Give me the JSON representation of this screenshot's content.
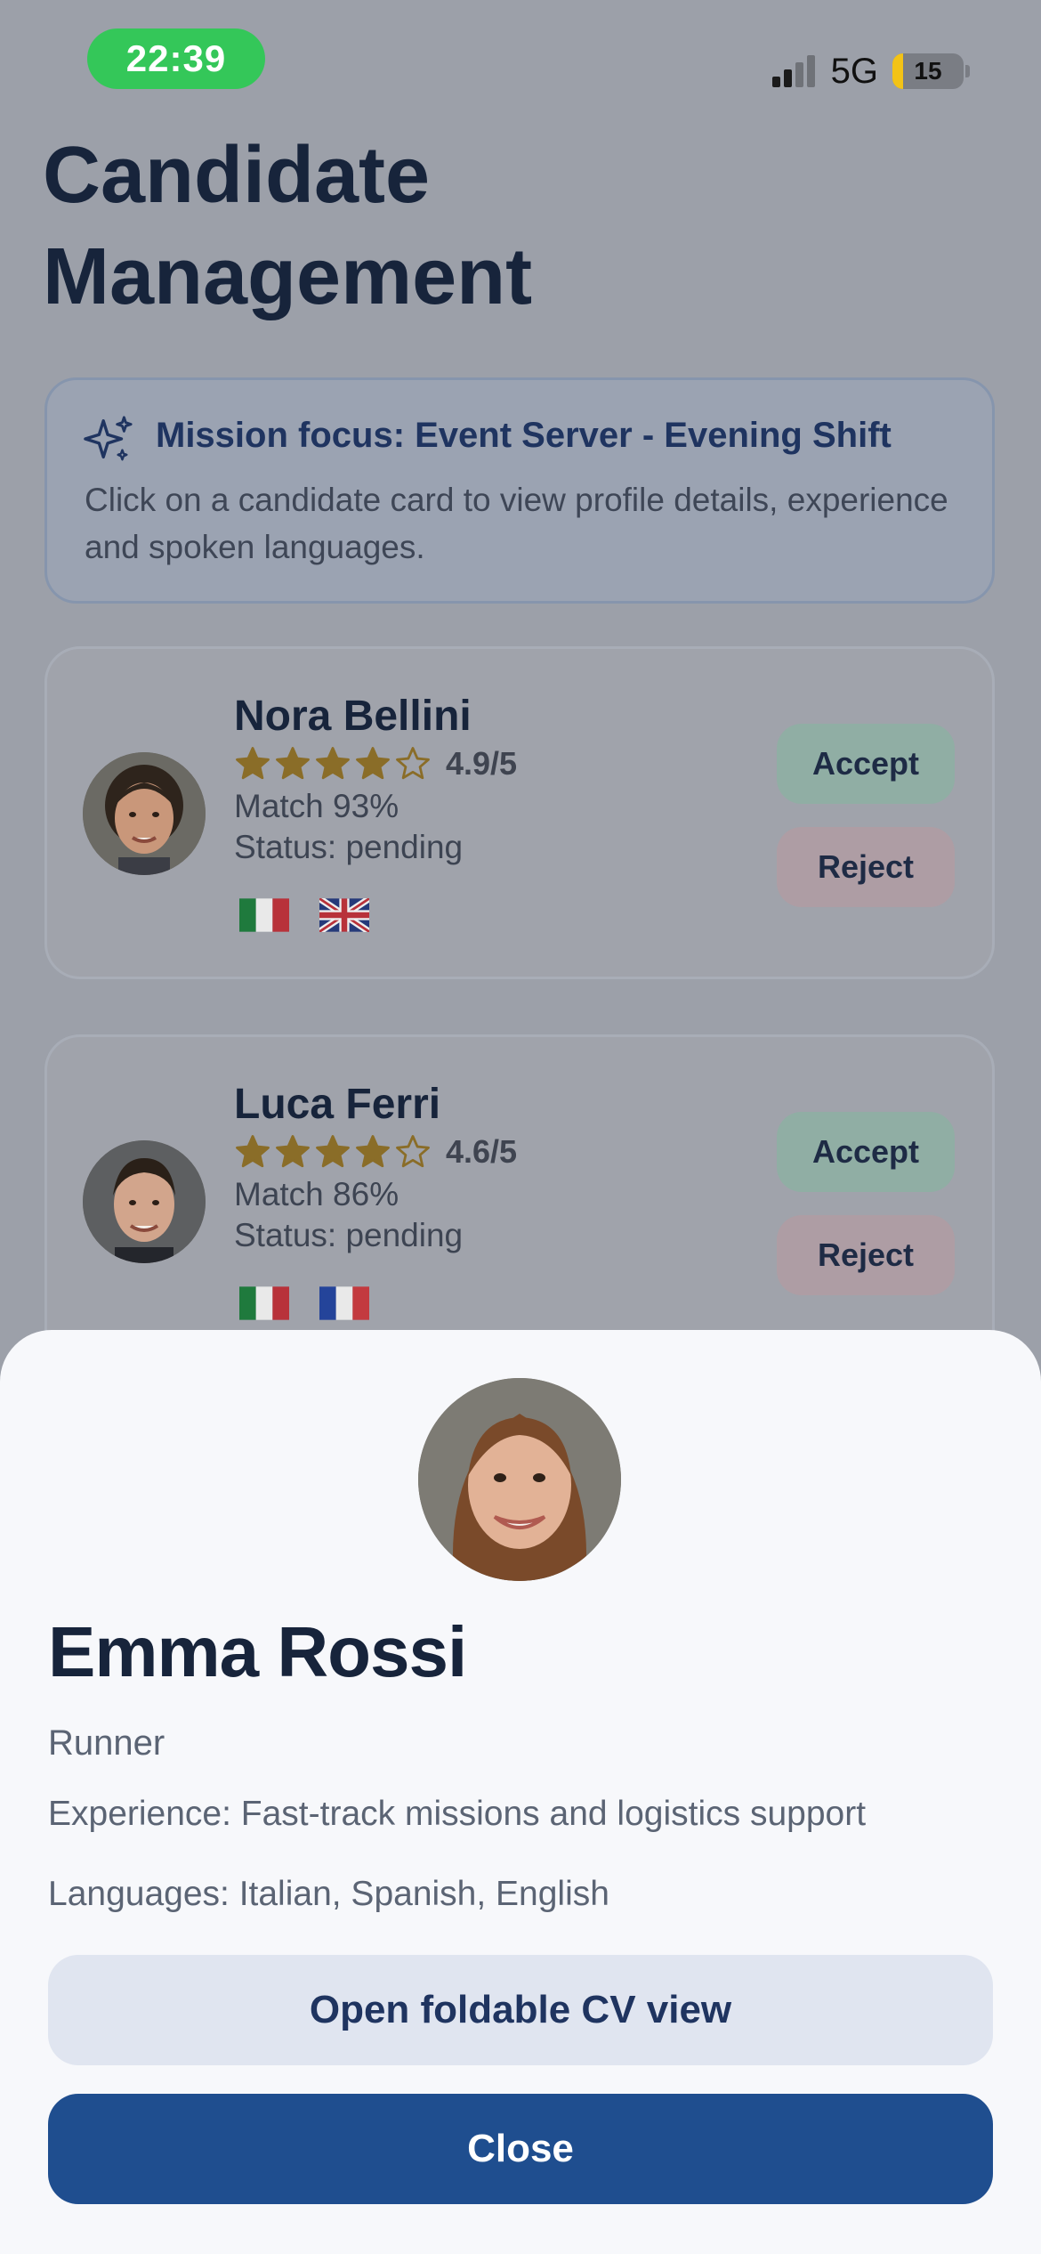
{
  "status_bar": {
    "time": "22:39",
    "network": "5G",
    "battery": "15"
  },
  "header": {
    "title": "Candidate Management"
  },
  "mission": {
    "title": "Mission focus: Event Server - Evening Shift",
    "description": "Click on a candidate card to view profile details, experience and spoken languages.",
    "icon": "sparkle-icon"
  },
  "candidates": [
    {
      "name": "Nora Bellini",
      "stars": 4,
      "rating": "4.9/5",
      "match": "Match 93%",
      "status": "Status: pending",
      "languages_flags": [
        "flag-italy",
        "flag-uk"
      ],
      "accept_label": "Accept",
      "reject_label": "Reject"
    },
    {
      "name": "Luca Ferri",
      "stars": 4,
      "rating": "4.6/5",
      "match": "Match 86%",
      "status": "Status: pending",
      "languages_flags": [
        "flag-italy",
        "flag-france"
      ],
      "accept_label": "Accept",
      "reject_label": "Reject"
    }
  ],
  "sheet": {
    "name": "Emma Rossi",
    "role": "Runner",
    "experience": "Experience: Fast-track missions and logistics support",
    "languages": "Languages: Italian, Spanish, English",
    "cv_button": "Open foldable CV view",
    "close_button": "Close"
  },
  "colors": {
    "accent": "#1f4e8f",
    "title": "#17243b",
    "star": "#8a6d28",
    "accept": "#90aea4",
    "reject": "#ae9da4",
    "time_pill": "#34c759"
  }
}
